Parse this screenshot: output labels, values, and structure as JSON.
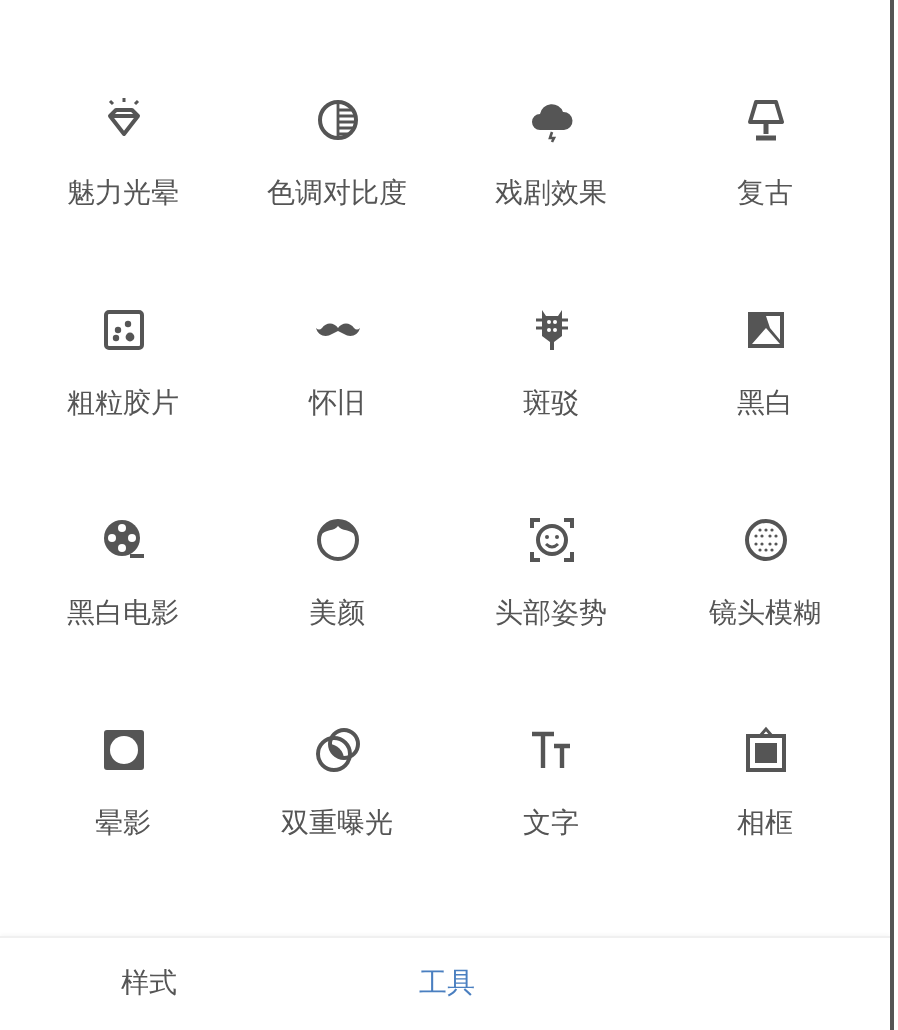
{
  "tools": [
    {
      "kind": "diamond",
      "label": "魅力光晕"
    },
    {
      "kind": "contrast",
      "label": "色调对比度"
    },
    {
      "kind": "cloud",
      "label": "戏剧效果"
    },
    {
      "kind": "lamp",
      "label": "复古"
    },
    {
      "kind": "grain",
      "label": "粗粒胶片"
    },
    {
      "kind": "mustache",
      "label": "怀旧"
    },
    {
      "kind": "guitar",
      "label": "斑驳"
    },
    {
      "kind": "bw",
      "label": "黑白"
    },
    {
      "kind": "film",
      "label": "黑白电影"
    },
    {
      "kind": "face",
      "label": "美颜"
    },
    {
      "kind": "headpose",
      "label": "头部姿势"
    },
    {
      "kind": "blur",
      "label": "镜头模糊"
    },
    {
      "kind": "vignette",
      "label": "晕影"
    },
    {
      "kind": "double",
      "label": "双重曝光"
    },
    {
      "kind": "text",
      "label": "文字"
    },
    {
      "kind": "frame",
      "label": "相框"
    }
  ],
  "tabs": [
    {
      "label": "样式",
      "selected": false
    },
    {
      "label": "工具",
      "selected": true
    }
  ]
}
